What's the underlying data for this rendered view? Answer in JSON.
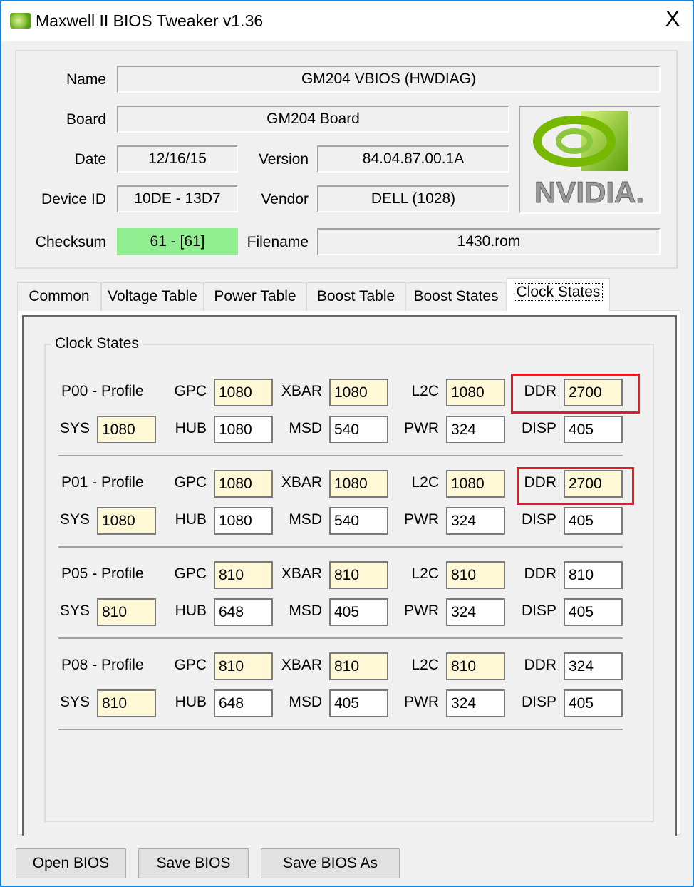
{
  "window": {
    "title": "Maxwell II BIOS Tweaker v1.36",
    "close_label": "X"
  },
  "info": {
    "name_label": "Name",
    "name": "GM204 VBIOS (HWDIAG)",
    "board_label": "Board",
    "board": "GM204 Board",
    "date_label": "Date",
    "date": "12/16/15",
    "version_label": "Version",
    "version": "84.04.87.00.1A",
    "device_label": "Device ID",
    "device": "10DE - 13D7",
    "vendor_label": "Vendor",
    "vendor": "DELL (1028)",
    "checksum_label": "Checksum",
    "checksum": "61 - [61]",
    "filename_label": "Filename",
    "filename": "1430.rom",
    "logo_text": "NVIDIA."
  },
  "colors": {
    "checksum_ok": "#90ee90",
    "highlight_field": "#fff8d6",
    "annotation": "#e31c23",
    "border": "#1883d7"
  },
  "tabs": [
    "Common",
    "Voltage Table",
    "Power Table",
    "Boost Table",
    "Boost States",
    "Clock States"
  ],
  "active_tab": "Clock States",
  "clock_states": {
    "group_title": "Clock States",
    "field_labels": [
      "GPC",
      "XBAR",
      "L2C",
      "DDR",
      "SYS",
      "HUB",
      "MSD",
      "PWR",
      "DISP"
    ],
    "profiles": [
      {
        "name": "P00 - Profile",
        "values": {
          "GPC": "1080",
          "XBAR": "1080",
          "L2C": "1080",
          "DDR": "2700",
          "SYS": "1080",
          "HUB": "1080",
          "MSD": "540",
          "PWR": "324",
          "DISP": "405"
        },
        "ddr_highlighted": true,
        "annotated": true
      },
      {
        "name": "P01 - Profile",
        "values": {
          "GPC": "1080",
          "XBAR": "1080",
          "L2C": "1080",
          "DDR": "2700",
          "SYS": "1080",
          "HUB": "1080",
          "MSD": "540",
          "PWR": "324",
          "DISP": "405"
        },
        "ddr_highlighted": true,
        "annotated": true
      },
      {
        "name": "P05 - Profile",
        "values": {
          "GPC": "810",
          "XBAR": "810",
          "L2C": "810",
          "DDR": "810",
          "SYS": "810",
          "HUB": "648",
          "MSD": "405",
          "PWR": "324",
          "DISP": "405"
        },
        "ddr_highlighted": false,
        "annotated": false
      },
      {
        "name": "P08 - Profile",
        "values": {
          "GPC": "810",
          "XBAR": "810",
          "L2C": "810",
          "DDR": "324",
          "SYS": "810",
          "HUB": "648",
          "MSD": "405",
          "PWR": "324",
          "DISP": "405"
        },
        "ddr_highlighted": false,
        "annotated": false
      }
    ]
  },
  "buttons": {
    "open": "Open BIOS",
    "save": "Save BIOS",
    "save_as": "Save BIOS As"
  }
}
